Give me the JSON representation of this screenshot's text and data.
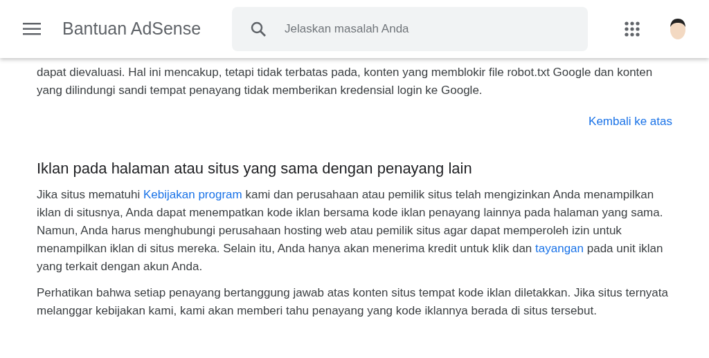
{
  "header": {
    "title": "Bantuan AdSense",
    "search": {
      "placeholder": "Jelaskan masalah Anda"
    }
  },
  "intro": "dapat dievaluasi. Hal ini mencakup, tetapi tidak terbatas pada, konten yang memblokir file robot.txt Google dan konten yang dilindungi sandi tempat penayang tidak memberikan kredensial login ke Google.",
  "back_to_top": "Kembali ke atas",
  "section": {
    "heading": "Iklan pada halaman atau situs yang sama dengan penayang lain",
    "paragraphs": [
      [
        {
          "kind": "text",
          "text": "Jika situs mematuhi "
        },
        {
          "kind": "link",
          "text": "Kebijakan program"
        },
        {
          "kind": "text",
          "text": " kami dan perusahaan atau pemilik situs telah mengizinkan Anda menampilkan iklan di situsnya, Anda dapat menempatkan kode iklan bersama kode iklan penayang lainnya pada halaman yang sama. Namun, Anda harus menghubungi perusahaan hosting web atau pemilik situs agar dapat memperoleh izin untuk menampilkan iklan di situs mereka. Selain itu, Anda hanya akan menerima kredit untuk klik dan "
        },
        {
          "kind": "link",
          "text": "tayangan"
        },
        {
          "kind": "text",
          "text": " pada unit iklan yang terkait dengan akun Anda."
        }
      ],
      [
        {
          "kind": "text",
          "text": "Perhatikan bahwa setiap penayang bertanggung jawab atas konten situs tempat kode iklan diletakkan. Jika situs ternyata melanggar kebijakan kami, kami akan memberi tahu penayang yang kode iklannya berada di situs tersebut."
        }
      ]
    ]
  }
}
